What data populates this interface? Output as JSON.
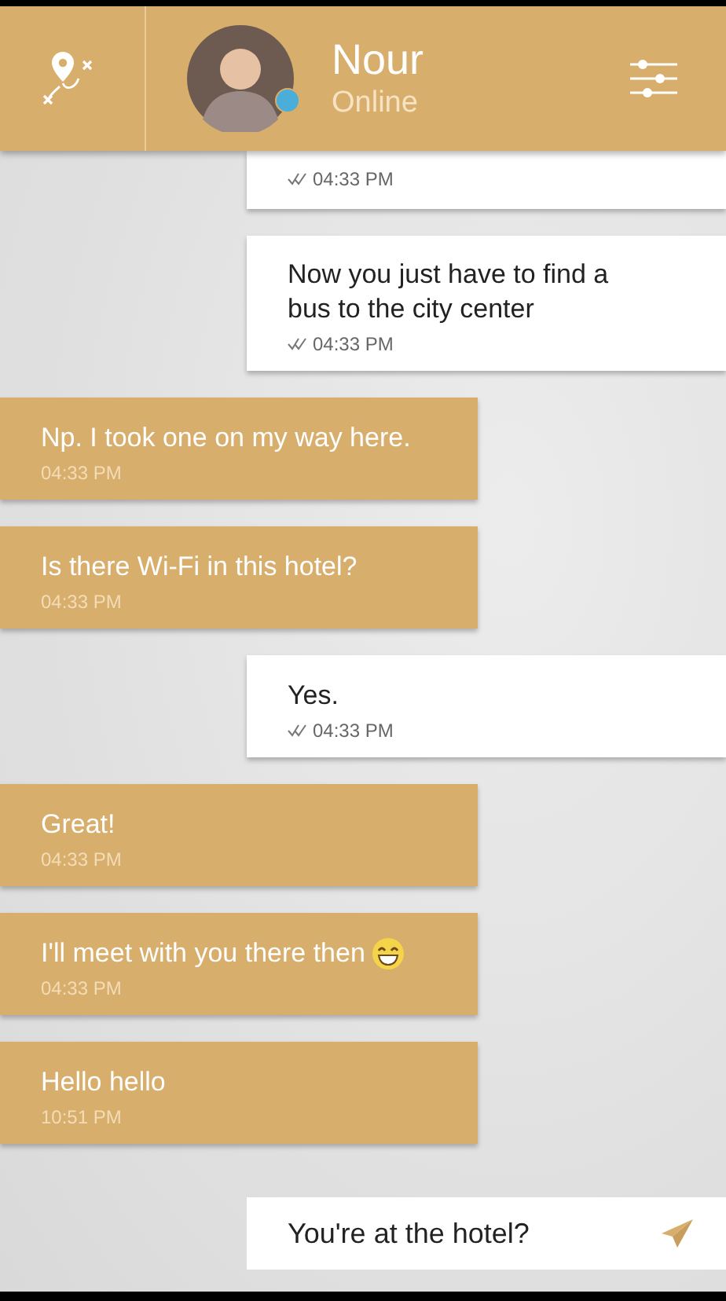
{
  "header": {
    "name": "Nour",
    "status": "Online",
    "online": true
  },
  "messages": [
    {
      "kind": "sent",
      "time": "04:33 PM",
      "clipped": true
    },
    {
      "kind": "sent",
      "text": "Now you just have to find a bus to the city center",
      "time": "04:33 PM"
    },
    {
      "kind": "received",
      "text": "Np. I took one on my way here.",
      "time": "04:33 PM"
    },
    {
      "kind": "received",
      "text": "Is there Wi-Fi in this hotel?",
      "time": "04:33 PM"
    },
    {
      "kind": "sent",
      "text": "Yes.",
      "time": "04:33 PM"
    },
    {
      "kind": "received",
      "text": "Great!",
      "time": "04:33 PM"
    },
    {
      "kind": "received",
      "text": "I'll meet with you there then",
      "time": "04:33 PM",
      "emoji": true
    },
    {
      "kind": "received",
      "text": "Hello hello",
      "time": "10:51 PM"
    }
  ],
  "composer": {
    "value": "You're at the hotel?"
  }
}
